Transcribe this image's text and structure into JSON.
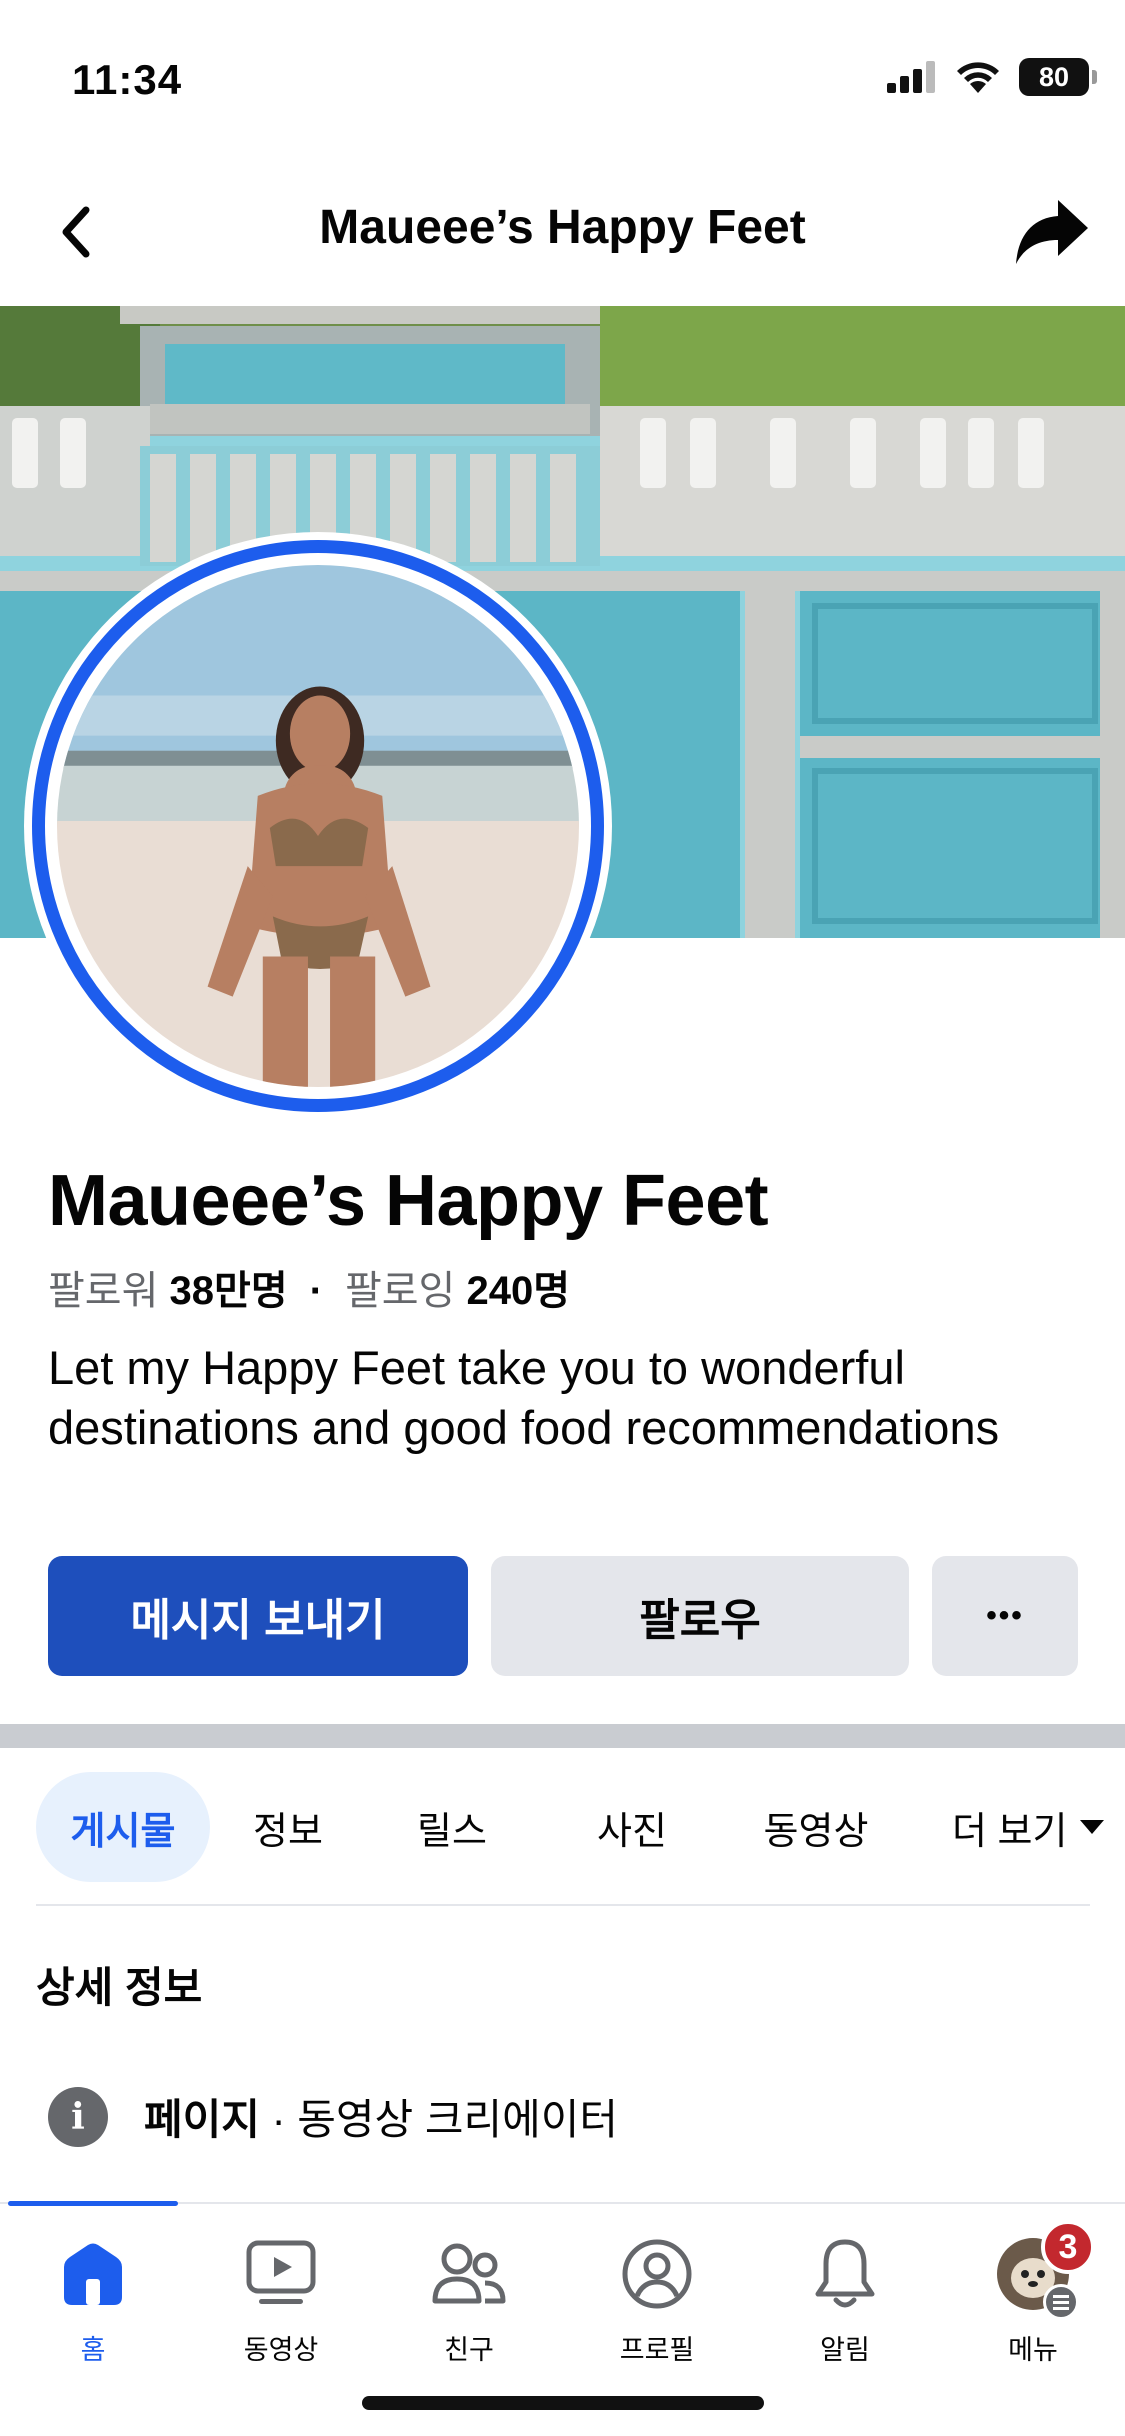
{
  "status_bar": {
    "time": "11:34",
    "battery": "80"
  },
  "nav": {
    "title": "Maueee’s Happy Feet"
  },
  "profile": {
    "name": "Maueee’s Happy Feet",
    "followers_label": "팔로워",
    "followers_value": "38만명",
    "following_label": "팔로잉",
    "following_value": "240명",
    "bio": "Let my Happy Feet take you to wonderful destinations and good food recommendations"
  },
  "actions": {
    "message": "메시지 보내기",
    "follow": "팔로우",
    "more": "•••"
  },
  "tabs": [
    {
      "label": "게시물",
      "active": true
    },
    {
      "label": "정보"
    },
    {
      "label": "릴스"
    },
    {
      "label": "사진"
    },
    {
      "label": "동영상"
    },
    {
      "label": "더 보기"
    }
  ],
  "details": {
    "title": "상세 정보",
    "page_label": "페이지",
    "category": " · 동영상 크리에이터"
  },
  "tabbar": [
    {
      "label": "홈",
      "icon": "home-icon",
      "active": true
    },
    {
      "label": "동영상",
      "icon": "video-icon"
    },
    {
      "label": "친구",
      "icon": "friends-icon"
    },
    {
      "label": "프로필",
      "icon": "profile-icon"
    },
    {
      "label": "알림",
      "icon": "bell-icon"
    },
    {
      "label": "메뉴",
      "icon": "menu-avatar",
      "badge": "3"
    }
  ],
  "colors": {
    "accent": "#1d5ded",
    "message_button": "#1e4fbc",
    "secondary_button": "#e4e6eb",
    "badge": "#c3282e"
  }
}
